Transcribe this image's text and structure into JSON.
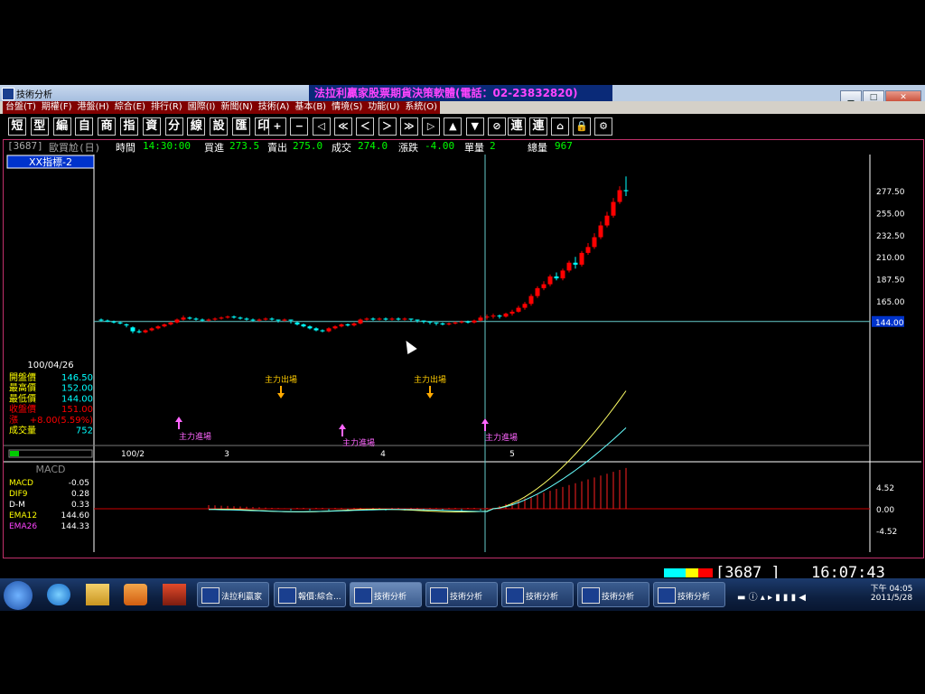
{
  "window": {
    "title": "技術分析",
    "brand": "法拉利贏家股票期貨決策軟體(電話：02-23832820)"
  },
  "menu": [
    "台盤(T)",
    "期權(F)",
    "港盤(H)",
    "綜合(E)",
    "排行(R)",
    "國際(I)",
    "新聞(N)",
    "技術(A)",
    "基本(B)",
    "情境(S)",
    "功能(U)",
    "系統(O)"
  ],
  "toolbar": [
    "短",
    "型",
    "編",
    "自",
    "商",
    "指",
    "資",
    "分",
    "線",
    "設",
    "匯",
    "印"
  ],
  "toolbar_right": [
    "連",
    "連"
  ],
  "status": {
    "code": "[3687]",
    "name": "歐買尬(日)",
    "time_label": "時間",
    "time": "14:30:00",
    "bid_label": "買進",
    "bid": "273.5",
    "ask_label": "賣出",
    "ask": "275.0",
    "deal_label": "成交",
    "deal": "274.0",
    "change_label": "漲跌",
    "change": "-4.00",
    "vol_label": "單量",
    "vol": "2",
    "total_label": "總量",
    "total": "967"
  },
  "indicator_tab": "XX指標-2",
  "info_panel": {
    "date": "100/04/26",
    "rows": [
      {
        "label": "開盤價",
        "value": "146.50",
        "label_color": "#ffff00",
        "value_color": "#00ffff"
      },
      {
        "label": "最高價",
        "value": "152.00",
        "label_color": "#ffff00",
        "value_color": "#00ffff"
      },
      {
        "label": "最低價",
        "value": "144.00",
        "label_color": "#ffff00",
        "value_color": "#00ffff"
      },
      {
        "label": "收盤價",
        "value": "151.00",
        "label_color": "#ff0000",
        "value_color": "#ff0000"
      },
      {
        "label": "漲",
        "value": "+8.00(5.59%)",
        "label_color": "#ff0000",
        "value_color": "#ff0000"
      },
      {
        "label": "成交量",
        "value": "752",
        "label_color": "#ffff00",
        "value_color": "#00ffff"
      }
    ]
  },
  "price_axis": [
    "277.50",
    "255.00",
    "232.50",
    "210.00",
    "187.50",
    "165.00",
    "144.00"
  ],
  "current_price": "144.00",
  "x_labels": [
    "100/2",
    "3",
    "4",
    "5"
  ],
  "annotations": {
    "exit": "主力出場",
    "enter": "主力進場"
  },
  "macd_title": "MACD",
  "macd_panel": [
    {
      "label": "MACD",
      "value": "-0.05",
      "label_color": "#ffff00"
    },
    {
      "label": "DIF9",
      "value": "0.28",
      "label_color": "#ffff00"
    },
    {
      "label": "D-M",
      "value": "0.33",
      "label_color": "#ffffff"
    },
    {
      "label": "EMA12",
      "value": "144.60",
      "label_color": "#ffff00"
    },
    {
      "label": "EMA26",
      "value": "144.33",
      "label_color": "#ff44ff"
    }
  ],
  "macd_axis": [
    "4.52",
    "0.00",
    "-4.52"
  ],
  "ticker": {
    "code": "3687_",
    "clock": "16:07:43"
  },
  "taskbar": {
    "tasks": [
      "法拉利贏家",
      "報價:綜合...",
      "技術分析",
      "技術分析",
      "技術分析",
      "技術分析",
      "技術分析"
    ],
    "clock_time": "下午 04:05",
    "clock_date": "2011/5/28"
  },
  "colors": {
    "up": "#ff0000",
    "down": "#00ffff",
    "brand_bg": "#0a2a78",
    "menu_bg": "#800000",
    "frame": "#c0306a"
  }
}
